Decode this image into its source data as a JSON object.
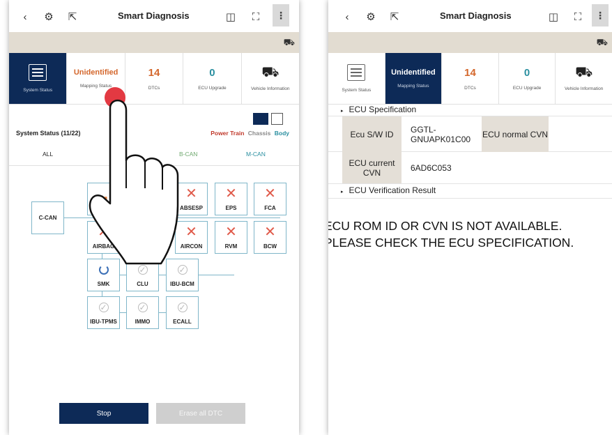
{
  "left": {
    "title": "Smart Diagnosis",
    "tabs": [
      {
        "value": "",
        "label": "System Status"
      },
      {
        "value": "Unidentified",
        "label": "Mapping Status"
      },
      {
        "value": "14",
        "label": "DTCs"
      },
      {
        "value": "0",
        "label": "ECU Upgrade"
      },
      {
        "value": "",
        "label": "Vehicle Information"
      }
    ],
    "system_status": "System Status (11/22)",
    "filters": [
      "Power Train",
      "Chassis",
      "Body"
    ],
    "can_tabs": [
      "ALL",
      "B-CAN",
      "M-CAN"
    ],
    "can_root": "C-CAN",
    "ecus": [
      {
        "name": "ABSESP",
        "status": "error"
      },
      {
        "name": "EPS",
        "status": "error"
      },
      {
        "name": "FCA",
        "status": "error"
      },
      {
        "name": "AIRBAG",
        "status": "error"
      },
      {
        "name": "AIRCON",
        "status": "error"
      },
      {
        "name": "RVM",
        "status": "error"
      },
      {
        "name": "BCW",
        "status": "error"
      },
      {
        "name": "SMK",
        "status": "loading"
      },
      {
        "name": "CLU",
        "status": "pending"
      },
      {
        "name": "IBU-BCM",
        "status": "pending"
      },
      {
        "name": "IBU-TPMS",
        "status": "pending"
      },
      {
        "name": "IMMO",
        "status": "pending"
      },
      {
        "name": "ECALL",
        "status": "pending"
      }
    ],
    "buttons": {
      "stop": "Stop",
      "erase": "Erase all DTC"
    }
  },
  "right": {
    "title": "Smart Diagnosis",
    "tabs": [
      {
        "value": "",
        "label": "System Status"
      },
      {
        "value": "Unidentified",
        "label": "Mapping Status"
      },
      {
        "value": "14",
        "label": "DTCs"
      },
      {
        "value": "0",
        "label": "ECU Upgrade"
      },
      {
        "value": "",
        "label": "Vehicle Information"
      }
    ],
    "spec_header": "ECU Specification",
    "sw_id_label": "Ecu S/W ID",
    "sw_id_value": "GGTL-GNUAPK01C00",
    "normal_cvn_label": "ECU normal CVN",
    "current_cvn_label": "ECU current CVN",
    "current_cvn_value": "6AD6C053",
    "verify_header": "ECU Verification Result",
    "message_line1": "ECU ROM ID OR CVN IS NOT AVAILABLE.",
    "message_line2": "PLEASE CHECK THE ECU SPECIFICATION."
  },
  "colors": {
    "navy": "#0d2a57",
    "orange": "#d4672c",
    "teal": "#2a8fa0",
    "red": "#c0392b",
    "beige": "#e2dcd1"
  },
  "icons": [
    "back-icon",
    "scan-icon",
    "export-icon",
    "vci-icon",
    "screenshot-icon",
    "more-icon",
    "car-icon",
    "system-status-icon",
    "vehicle-info-icon",
    "grid-view-icon",
    "list-view-icon",
    "hand-gesture-icon"
  ]
}
